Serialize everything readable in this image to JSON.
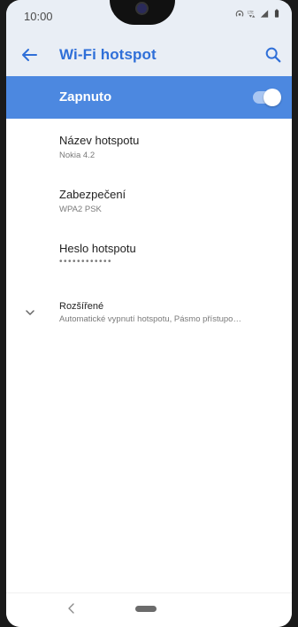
{
  "status_bar": {
    "time": "10:00",
    "icons": [
      "hotspot-icon",
      "lte-icon",
      "signal-icon",
      "battery-icon"
    ]
  },
  "app_bar": {
    "title": "Wi-Fi hotspot",
    "back_icon": "arrow-left-icon",
    "search_icon": "search-icon"
  },
  "master_switch": {
    "label": "Zapnuto",
    "state": true
  },
  "settings": [
    {
      "title": "Název hotspotu",
      "summary": "Nokia 4.2"
    },
    {
      "title": "Zabezpečení",
      "summary": "WPA2 PSK"
    },
    {
      "title": "Heslo hotspotu",
      "summary": "••••••••••••"
    }
  ],
  "advanced": {
    "title": "Rozšířené",
    "summary": "Automatické vypnutí hotspotu, Pásmo přístupo…"
  },
  "nav_bar": {
    "back_icon": "nav-back-icon",
    "home_icon": "home-pill-icon"
  },
  "colors": {
    "accent": "#2f6fd8",
    "switch_bar": "#4c88e0",
    "app_bar_bg": "#e9eef5"
  }
}
